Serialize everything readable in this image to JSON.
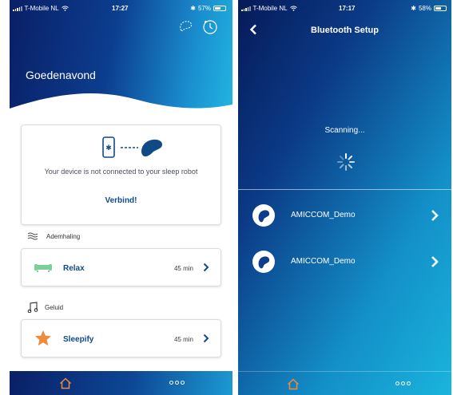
{
  "left": {
    "status": {
      "carrier": "T-Mobile NL",
      "time": "17:27",
      "battery": "57%",
      "battery_level": 0.57
    },
    "greeting": "Goedenavond",
    "connection_card": {
      "message": "Your device is not connected to your sleep robot",
      "action": "Verbind!"
    },
    "sections": [
      {
        "label": "Ademhaling",
        "icon": "waves-icon",
        "item": {
          "name": "Relax",
          "duration": "45 min",
          "icon": "sofa-icon"
        }
      },
      {
        "label": "Geluid",
        "icon": "music-note-icon",
        "item": {
          "name": "Sleepify",
          "duration": "45 min",
          "icon": "star-icon"
        }
      }
    ],
    "tabbar": {
      "home_icon": "home-icon",
      "more_icon": "more-icon"
    }
  },
  "right": {
    "status": {
      "carrier": "T-Mobile NL",
      "time": "17:17",
      "battery": "58%",
      "battery_level": 0.58
    },
    "title": "Bluetooth Setup",
    "scanning_text": "Scanning...",
    "devices": [
      {
        "name": "AMICCOM_Demo"
      },
      {
        "name": "AMICCOM_Demo"
      }
    ],
    "tabbar": {
      "home_icon": "home-icon",
      "more_icon": "more-icon"
    }
  },
  "colors": {
    "accent_blue": "#0f4a88",
    "header_dark": "#0a1f66",
    "header_light": "#21b6e2",
    "home_orange": "#f08a3c",
    "star_orange": "#f08a3c",
    "sofa_green": "#7ccf9a"
  }
}
